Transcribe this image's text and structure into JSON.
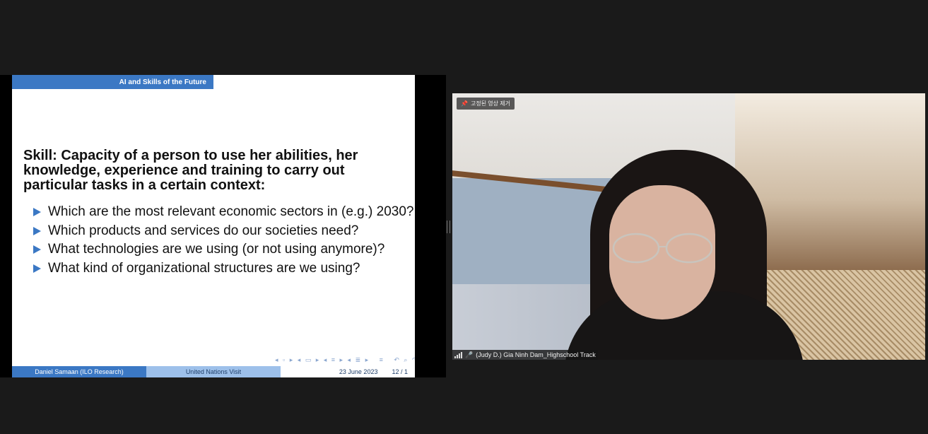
{
  "slide": {
    "header": "AI and Skills of the Future",
    "title": "Skill: Capacity of a person to use her abilities, her knowledge, experience and training to carry out particular tasks in a certain context:",
    "bullets": [
      "Which are the most relevant economic sectors in (e.g.) 2030?",
      "Which products and services do our societies need?",
      "What technologies are we using (or not using anymore)?",
      "What kind of organizational structures are we using?"
    ],
    "footer": {
      "author": "Daniel Samaan  (ILO Research)",
      "event": "United Nations Visit",
      "date": "23 June 2023",
      "page": "12 / 1"
    }
  },
  "video": {
    "pin_label": "고정된 영상 제거",
    "participant_name": "(Judy D.) Gia Ninh Dam_Highschool Track"
  },
  "colors": {
    "slide_accent": "#3b78c4",
    "slide_accent_light": "#9dc0ea",
    "background": "#1a1a1a"
  }
}
